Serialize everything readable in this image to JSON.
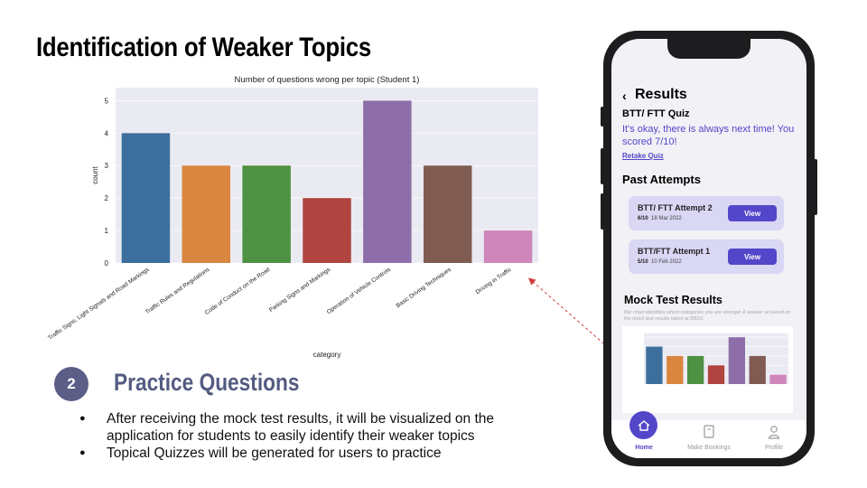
{
  "slide": {
    "title": "Identification of Weaker Topics",
    "section_number": "2",
    "section_title": "Practice Questions",
    "bullets": [
      "After receiving the mock test results, it will be visualized on the application for students to easily identify their weaker topics",
      "Topical Quizzes will be generated for users to practice"
    ]
  },
  "chart_data": {
    "type": "bar",
    "title": "Number of questions wrong per topic (Student 1)",
    "xlabel": "category",
    "ylabel": "count",
    "ylim": [
      0,
      5.4
    ],
    "yticks": [
      0,
      1,
      2,
      3,
      4,
      5
    ],
    "grid": true,
    "categories": [
      "Traffic Signs, Light Signals and Road Markings",
      "Traffic Rules and Regulations",
      "Code of Conduct on the Road",
      "Parking Signs and Markings",
      "Operation of Vehicle Controls",
      "Basic Driving Techniques",
      "Driving in Traffic"
    ],
    "values": [
      4,
      3,
      3,
      2,
      5,
      3,
      1
    ],
    "colors": [
      "#3c6f9e",
      "#d88640",
      "#4e9142",
      "#b04440",
      "#8d6ea9",
      "#805b52",
      "#cf86ba"
    ]
  },
  "phone": {
    "back_icon": "chevron-left-icon",
    "title": "Results",
    "quiz_name": "BTT/ FTT Quiz",
    "quiz_message": "It's okay, there is always next time! You scored 7/10!",
    "retake_label": "Retake Quiz",
    "past_attempts_title": "Past Attempts",
    "attempts": [
      {
        "name": "BTT/ FTT Attempt 2",
        "score": "6/10",
        "date": "18 Mar 2022",
        "button": "View"
      },
      {
        "name": "BTT/FTT Attempt 1",
        "score": "5/10",
        "date": "10 Feb 2022",
        "button": "View"
      }
    ],
    "mock_title": "Mock Test Results",
    "mock_desc": "Bar chart identifies which categories you are stronger & weaker at based on the mock test results taken at BBDC",
    "nav": [
      {
        "label": "Home",
        "icon": "home-icon",
        "active": true
      },
      {
        "label": "Make Bookings",
        "icon": "document-icon",
        "active": false
      },
      {
        "label": "Profile",
        "icon": "user-icon",
        "active": false
      }
    ],
    "accent": "#5446c9"
  }
}
